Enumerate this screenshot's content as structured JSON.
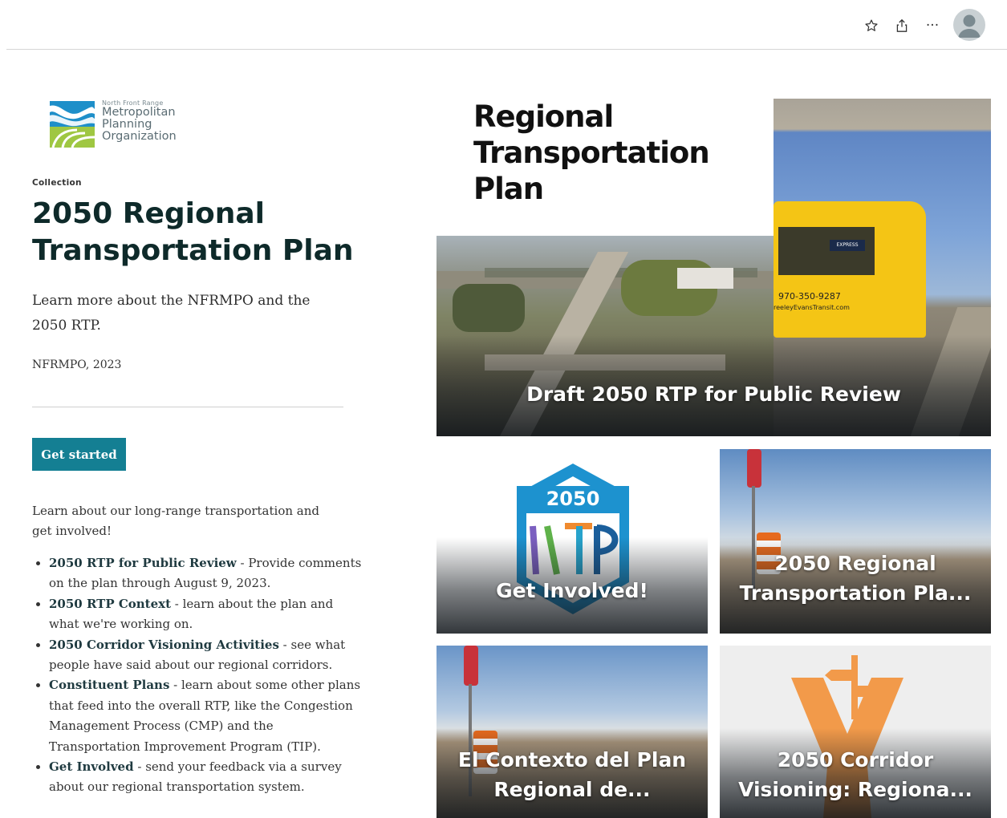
{
  "header": {
    "favorite_icon": "star-icon",
    "share_icon": "share-icon",
    "more_icon": "more-horizontal-icon",
    "more_glyph": "···",
    "avatar_icon": "user-avatar-icon"
  },
  "logo": {
    "small": "North Front Range",
    "line1": "Metropolitan",
    "line2": "Planning",
    "line3": "Organization"
  },
  "collection": {
    "eyebrow": "Collection",
    "title": "2050 Regional Transportation Plan",
    "summary": "Learn more about the NFRMPO and the 2050 RTP.",
    "meta": "NFRMPO, 2023",
    "button": "Get started",
    "intro": "Learn about our long-range transportation and get involved!",
    "items": [
      {
        "link": "2050 RTP for Public Review",
        "text": " - Provide comments on the plan through August 9, 2023."
      },
      {
        "link": "2050 RTP Context",
        "text": " - learn about the plan and what we're working on."
      },
      {
        "link": "2050 Corridor Visioning Activities",
        "text": " - see what people have said about our regional corridors."
      },
      {
        "link": "Constituent Plans",
        "text": " - learn about some other plans that feed into the overall RTP, like the Congestion Management Process (CMP) and the Transportation Improvement Program (TIP)."
      },
      {
        "link": "Get Involved",
        "text": " - send your feedback via a survey about our regional transportation system."
      }
    ]
  },
  "cards": {
    "hero": {
      "heading_line1": "Regional",
      "heading_line2": "Transportation",
      "heading_line3": "Plan",
      "bus_phone": "970-350-9287",
      "bus_site": "reeleyEvansTransit.com",
      "bus_badge": "EXPRESS",
      "title": "Draft 2050 RTP for Public Review"
    },
    "involved": {
      "badge_year": "2050",
      "badge_letters": "RTP",
      "title": "Get Involved!"
    },
    "regional": {
      "title_line1": "2050 Regional",
      "title_line2": "Transportation Pla..."
    },
    "contexto": {
      "title_line1": "El Contexto del Plan",
      "title_line2": "Regional de..."
    },
    "corridor": {
      "title_line1": "2050 Corridor",
      "title_line2": "Visioning: Regiona..."
    }
  }
}
